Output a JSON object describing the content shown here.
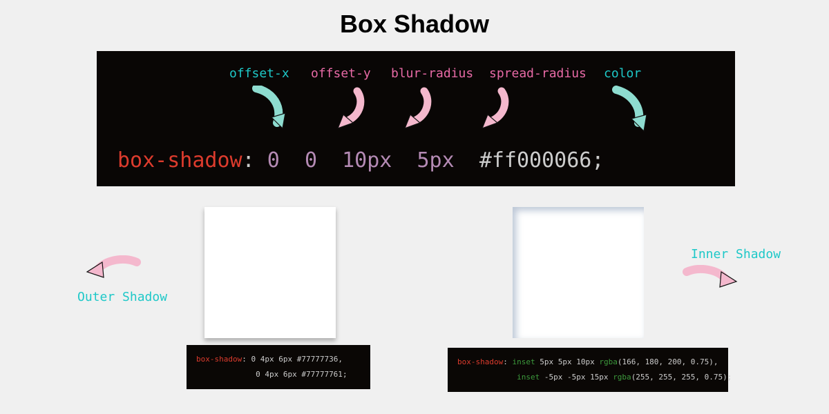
{
  "title": "Box Shadow",
  "hero": {
    "property": "box-shadow",
    "colon": ":",
    "labels": {
      "offset_x": "offset-x",
      "offset_y": "offset-y",
      "blur_radius": "blur-radius",
      "spread_radius": "spread-radius",
      "color": "color"
    },
    "values": {
      "offset_x": "0",
      "offset_y": "0",
      "blur": "10px",
      "spread": "5px",
      "hex": "#ff000066",
      "terminator": ";"
    }
  },
  "outer": {
    "label": "Outer Shadow",
    "code": {
      "property": "box-shadow",
      "colon": ":",
      "line1_vals": " 0 4px 6px ",
      "line1_hex": "#77777736",
      "line1_comma": ",",
      "indent": "             ",
      "line2_vals": "0 4px 6px ",
      "line2_hex": "#77777761",
      "terminator": ";"
    }
  },
  "inner": {
    "label": "Inner Shadow",
    "code": {
      "property": "box-shadow",
      "colon": ":",
      "sp1": " ",
      "inset1": "inset",
      "v1": " 5px 5px 10px ",
      "rgba_kw": "rgba",
      "rgba1": "(166, 180, 200, 0.75)",
      "comma": ",",
      "indent": "             ",
      "inset2": "inset",
      "v2": " -5px -5px 15px ",
      "rgba2": "(255, 255, 255, 0.75)",
      "terminator": ";"
    }
  }
}
